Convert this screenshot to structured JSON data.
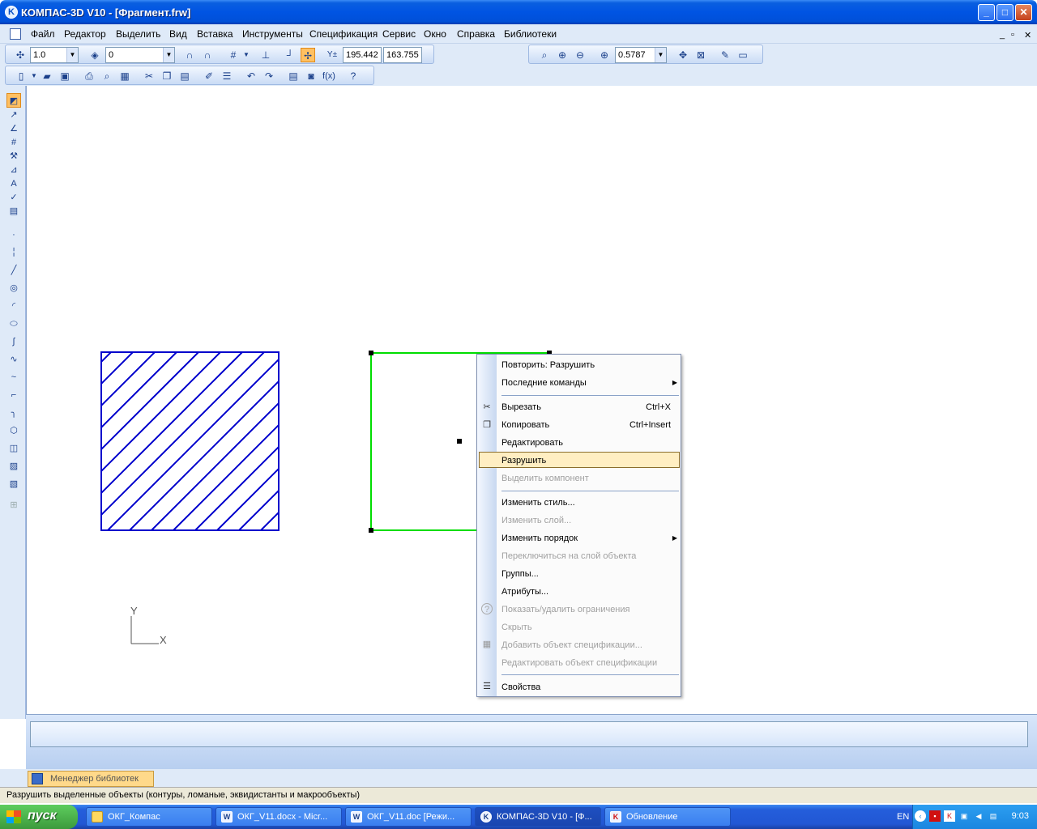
{
  "app": {
    "title": "КОМПАС-3D V10 - [Фрагмент.frw]",
    "logo_letter": "K"
  },
  "menu": {
    "items": [
      "Файл",
      "Редактор",
      "Выделить",
      "Вид",
      "Вставка",
      "Инструменты",
      "Спецификация",
      "Сервис",
      "Окно",
      "Справка",
      "Библиотеки"
    ]
  },
  "toolbar": {
    "scale_value": "1.0",
    "layer_value": "0",
    "coord_x": "195.442",
    "coord_y": "163.755",
    "zoom_value": "0.5787",
    "fx_label": "f(x)",
    "coord_axis_label": "Y±"
  },
  "context_menu": {
    "repeat": "Повторить: Разрушить",
    "recent": "Последние команды",
    "cut": "Вырезать",
    "cut_shortcut": "Ctrl+X",
    "copy": "Копировать",
    "copy_shortcut": "Ctrl+Insert",
    "edit": "Редактировать",
    "destroy": "Разрушить",
    "select_component": "Выделить компонент",
    "change_style": "Изменить стиль...",
    "change_layer": "Изменить слой...",
    "change_order": "Изменить порядок",
    "switch_layer": "Переключиться на слой объекта",
    "groups": "Группы...",
    "attributes": "Атрибуты...",
    "constraints": "Показать/удалить ограничения",
    "hide": "Скрыть",
    "add_spec": "Добавить объект спецификации...",
    "edit_spec": "Редактировать объект спецификации",
    "properties": "Свойства"
  },
  "canvas": {
    "axis_x": "X",
    "axis_y": "Y"
  },
  "library_tab": "Менеджер библиотек",
  "status_text": "Разрушить выделенные объекты (контуры, ломаные, эквидистанты и макрообъекты)",
  "taskbar": {
    "start": "пуск",
    "tasks": [
      "ОКГ_Компас",
      "ОКГ_V11.docx - Micr...",
      "ОКГ_V11.doc [Режи...",
      "КОМПАС-3D V10 - [Ф...",
      "Обновление"
    ],
    "lang": "EN",
    "clock": "9:03"
  },
  "colors": {
    "hatch_blue": "#0000cc",
    "selection_green": "#00dd00",
    "menu_highlight": "#ffeec2"
  }
}
